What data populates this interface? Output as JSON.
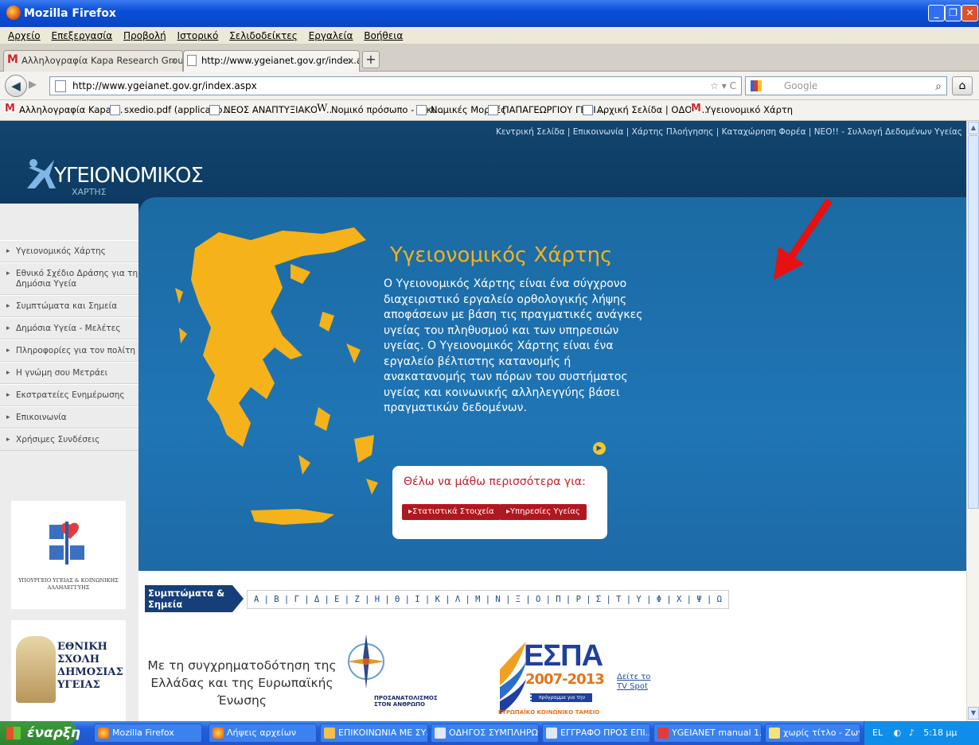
{
  "window": {
    "title": "Mozilla Firefox",
    "minimize": "_",
    "maximize": "❐",
    "close": "✕"
  },
  "menu": [
    "Αρχείο",
    "Επεξεργασία",
    "Προβολή",
    "Ιστορικό",
    "Σελιδοδείκτες",
    "Εργαλεία",
    "Βοήθεια"
  ],
  "tabs": [
    {
      "label": "Αλληλογραφία Kapa Research Group - lin...",
      "close": "×"
    },
    {
      "label": "http://www.ygeianet.gov.gr/index.aspx",
      "close": "×"
    }
  ],
  "new_tab": "+",
  "nav": {
    "back": "◀",
    "forward": "▶",
    "url": "http://www.ygeianet.gov.gr/index.aspx",
    "url_right": "☆ ▾ C",
    "search_placeholder": "Google",
    "search_btn": "⌕",
    "home": "⌂"
  },
  "bookmarks": [
    "Αλληλογραφία Kapa ...",
    "sxedio.pdf (applicatio...",
    "ΝΕΟΣ ΑΝΑΠΤΥΞΙΑΚΟΣ...",
    "Νομικό πρόσωπο - Βικι...",
    "Νομικές Μορφές",
    "ΠΑΠΑΓΕΩΡΓΙΟΥ ΓΕΝΙ...",
    "Αρχική Σελίδα | ΟΔΟΝ...",
    "Υγειονομικό Χάρτη"
  ],
  "site": {
    "toplinks": "Κεντρική Σελίδα | Επικοινωνία | Χάρτης Πλοήγησης | Καταχώρηση Φορέα | ΝΕΟ!! - Συλλογή Δεδομένων Υγείας",
    "logo_main": "ΥΓΕΙΟΝΟΜΙΚΟΣ",
    "logo_sub": "ΧΑΡΤΗΣ",
    "nav": [
      "Υγειονομικός Χάρτης",
      "Εθνικό Σχέδιο Δράσης για τη Δημόσια Υγεία",
      "Συμπτώματα και Σημεία",
      "Δημόσια Υγεία - Μελέτες",
      "Πληροφορίες για τον πολίτη",
      "Η γνώμη σου Μετράει",
      "Εκστρατείες Ενημέρωσης",
      "Επικοινωνία",
      "Χρήσιμες Συνδέσεις"
    ],
    "ministry": "ΥΠΟΥΡΓΕΙΟ ΥΓΕΙΑΣ & ΚΟΙΝΩΝΙΚΗΣ ΑΛΛΗΛΕΓΓΥΗΣ",
    "school": "ΕΘΝΙΚΗ ΣΧΟΛΗ ΔΗΜΟΣΙΑΣ ΥΓΕΙΑΣ",
    "hero_title": "Υγειονομικός Χάρτης",
    "hero_text": "Ο Υγειονομικός Χάρτης είναι ένα σύγχρονο διαχειριστικό εργαλείο ορθολογικής λήψης αποφάσεων με βάση τις πραγματικές ανάγκες υγείας του πληθυσμού και των υπηρεσιών υγείας. Ο Υγειονομικός Χάρτης είναι ένα εργαλείο βέλτιστης κατανομής ή ανακατανομής των πόρων του συστήματος υγείας και κοινωνικής αλληλεγγύης βάσει πραγματικών δεδομένων.",
    "learn_title": "Θέλω να μάθω περισσότερα για:",
    "learn_btns": [
      "▸Στατιστικά Στοιχεία",
      "▸Υπηρεσίες Υγείας"
    ],
    "alpha_label": "Συμπτώματα & Σημεία",
    "letters": "Α | Β | Γ | Δ | Ε | Ζ | Η | Θ | Ι | Κ | Λ | Μ | Ν | Ξ | Ο | Π | Ρ | Σ | Τ | Υ | Φ | Χ | Ψ | Ω",
    "cofund": "Με τη συγχρηματοδότηση της Ελλάδας και της Ευρωπαϊκής Ένωσης",
    "compass_label": "ΠΡΟΣΑΝΑΤΟΛΙΣΜΟΣ ΣΤΟΝ ΑΝΘΡΩΠΟ",
    "espa": "ΕΣΠΑ",
    "espa_years": "2007-2013",
    "espa_note": "πρόγραμμα για την ανάπτυξη",
    "espa_foot": "ΕΥΡΩΠΑΪΚΟ ΚΟΙΝΩΝΙΚΟ ΤΑΜΕΙΟ",
    "tvspot": "Δείτε το TV Spot"
  },
  "taskbar": {
    "start": "έναρξη",
    "items": [
      "Mozilla Firefox",
      "Λήψεις αρχείων",
      "ΕΠΙΚΟΙΝΩΝΙΑ ΜΕ ΣΥ...",
      "ΟΔΗΓΟΣ ΣΥΜΠΛΗΡΩ...",
      "ΕΓΓΡΑΦΟ ΠΡΟΣ ΕΠΙ...",
      "YGEIANET manual 1....",
      "χωρίς τίτλο - Ζωγρα..."
    ],
    "lang": "EL",
    "clock": "5:18 μμ"
  }
}
